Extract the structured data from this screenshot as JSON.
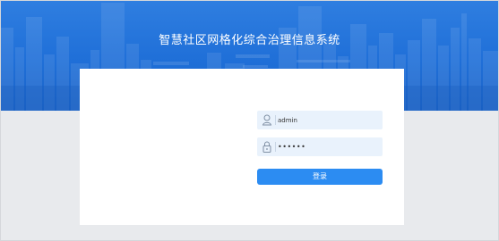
{
  "header": {
    "title": "智慧社区网格化综合治理信息系统"
  },
  "login": {
    "username": {
      "value": "admin",
      "icon": "user-icon"
    },
    "password": {
      "value": "••••••",
      "icon": "lock-icon"
    },
    "submit_label": "登录"
  },
  "colors": {
    "banner": "#1f6fd8",
    "button": "#2c8cf2",
    "field_bg": "#e9f2fc",
    "page_bg": "#e8eaed"
  }
}
